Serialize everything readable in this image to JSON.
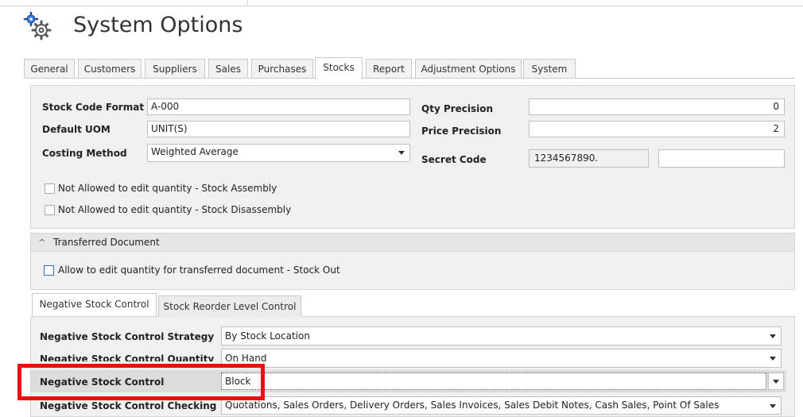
{
  "window": {
    "title": "System Options",
    "icon": "gear-icon"
  },
  "tabs": [
    {
      "label": "General"
    },
    {
      "label": "Customers"
    },
    {
      "label": "Suppliers"
    },
    {
      "label": "Sales"
    },
    {
      "label": "Purchases"
    },
    {
      "label": "Stocks",
      "active": true
    },
    {
      "label": "Report"
    },
    {
      "label": "Adjustment Options"
    },
    {
      "label": "System"
    }
  ],
  "stock": {
    "stock_code_format": {
      "label": "Stock Code Format",
      "value": "A-000"
    },
    "default_uom": {
      "label": "Default UOM",
      "value": "UNIT(S)"
    },
    "costing_method": {
      "label": "Costing Method",
      "value": "Weighted Average"
    },
    "qty_precision": {
      "label": "Qty Precision",
      "value": "0"
    },
    "price_precision": {
      "label": "Price Precision",
      "value": "2"
    },
    "secret_code": {
      "label": "Secret Code",
      "value": "1234567890.",
      "value2": ""
    },
    "cb_assembly": {
      "label": "Not Allowed to edit quantity - Stock Assembly",
      "checked": false
    },
    "cb_disassembly": {
      "label": "Not Allowed to edit quantity - Stock Disassembly",
      "checked": false
    }
  },
  "transferred": {
    "title": "Transferred Document",
    "cb_stock_out": {
      "label": "Allow to edit quantity for transferred document - Stock Out",
      "checked": false
    }
  },
  "subtabs": [
    {
      "label": "Negative Stock Control",
      "active": true
    },
    {
      "label": "Stock Reorder Level Control"
    }
  ],
  "negative": {
    "strategy": {
      "label": "Negative Stock Control Strategy",
      "value": "By Stock Location"
    },
    "quantity": {
      "label": "Negative Stock Control Quantity",
      "value": "On Hand"
    },
    "control": {
      "label": "Negative Stock Control",
      "value": "Block"
    },
    "checking": {
      "label": "Negative Stock Control Checking",
      "value": "Quotations, Sales Orders, Delivery Orders, Sales Invoices, Sales Debit Notes, Cash Sales, Point Of Sales"
    }
  },
  "colors": {
    "highlight": "#ee0e0e",
    "checkbox_accent": "#2f6ccf",
    "panel": "#f0f0f0"
  }
}
